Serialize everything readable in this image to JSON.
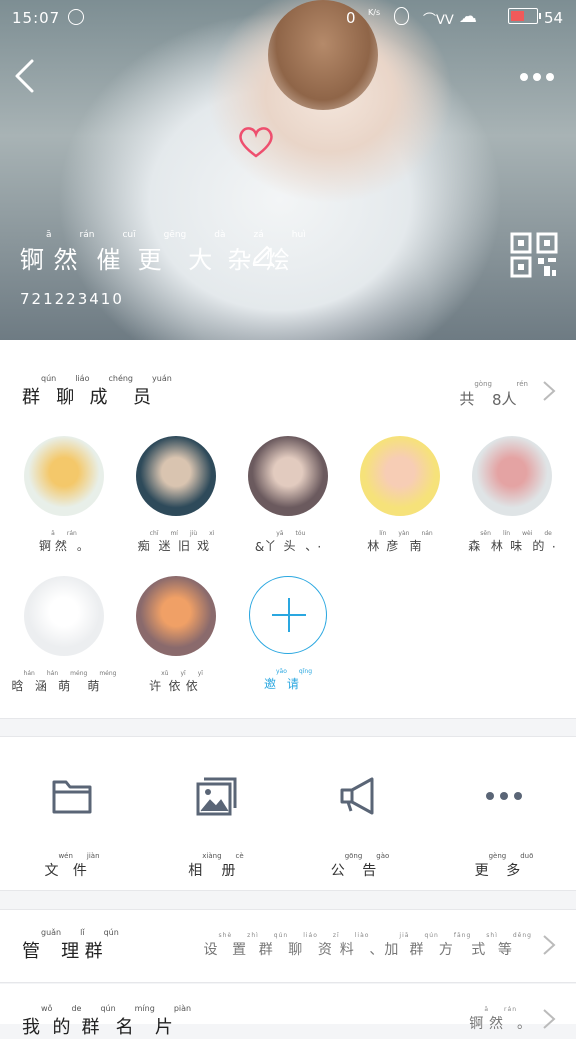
{
  "status_bar": {
    "time": "15:07",
    "speed_value": "0",
    "speed_unit": "K/s",
    "battery_level": "54",
    "battery_fraction": 0.54,
    "battery_color": "#f05a5a",
    "icons": [
      "globe-icon",
      "balloon-icon",
      "bunting-icon",
      "cloud-icon",
      "battery-icon"
    ]
  },
  "header": {
    "group_name": [
      {
        "char": "锕",
        "py": "ā"
      },
      {
        "char": "然",
        "py": "rán"
      },
      {
        "char": "催",
        "py": "cuī"
      },
      {
        "char": "更",
        "py": "gēng"
      },
      {
        "char": "大",
        "py": "dà"
      },
      {
        "char": "杂",
        "py": "zá"
      },
      {
        "char": "烩",
        "py": "huì"
      }
    ],
    "group_id": "721223410"
  },
  "members": {
    "title": [
      {
        "char": "群",
        "py": "qún"
      },
      {
        "char": "聊",
        "py": "liáo"
      },
      {
        "char": "成",
        "py": "chéng"
      },
      {
        "char": "员",
        "py": "yuán"
      }
    ],
    "count": [
      {
        "char": "共",
        "py": "gòng"
      },
      {
        "char": "8",
        "py": ""
      },
      {
        "char": "人",
        "py": "rén"
      }
    ],
    "list": [
      {
        "name": [
          {
            "char": "锕",
            "py": "ā"
          },
          {
            "char": "然",
            "py": "rán"
          },
          {
            "char": "。",
            "py": ""
          }
        ],
        "avatar_bg": "#e8efe9",
        "avatar_accent": "#f4c86a"
      },
      {
        "name": [
          {
            "char": "痴",
            "py": "chī"
          },
          {
            "char": "迷",
            "py": "mí"
          },
          {
            "char": "旧",
            "py": "jiù"
          },
          {
            "char": "戏",
            "py": "xì"
          }
        ],
        "avatar_bg": "#2e4a5a",
        "avatar_accent": "#d9c4b0"
      },
      {
        "name": [
          {
            "char": "&",
            "py": ""
          },
          {
            "char": "丫",
            "py": "yā"
          },
          {
            "char": "头",
            "py": "tóu"
          },
          {
            "char": "、",
            "py": ""
          },
          {
            "char": "·",
            "py": ""
          }
        ],
        "avatar_bg": "#6b5a5e",
        "avatar_accent": "#e2cbbf"
      },
      {
        "name": [
          {
            "char": "林",
            "py": "lín"
          },
          {
            "char": "彦",
            "py": "yàn"
          },
          {
            "char": "南",
            "py": "nán"
          }
        ],
        "avatar_bg": "#f6e27a",
        "avatar_accent": "#f7cdb5"
      },
      {
        "name": [
          {
            "char": "森",
            "py": "sēn"
          },
          {
            "char": "林",
            "py": "lín"
          },
          {
            "char": "味",
            "py": "wèi"
          },
          {
            "char": "的",
            "py": "de"
          },
          {
            "char": "·",
            "py": ""
          }
        ],
        "avatar_bg": "#dfe4e6",
        "avatar_accent": "#e4a3a3"
      },
      {
        "name": [
          {
            "char": "晗",
            "py": "hán"
          },
          {
            "char": "涵",
            "py": "hán"
          },
          {
            "char": "萌",
            "py": "méng"
          },
          {
            "char": "萌",
            "py": "méng"
          }
        ],
        "avatar_bg": "#eceef0",
        "avatar_accent": "#ffffff"
      },
      {
        "name": [
          {
            "char": "许",
            "py": "xǔ"
          },
          {
            "char": "依",
            "py": "yī"
          },
          {
            "char": "依",
            "py": "yī"
          }
        ],
        "avatar_bg": "#8a6a6c",
        "avatar_accent": "#f0a066"
      }
    ],
    "invite": [
      {
        "char": "邀",
        "py": "yāo"
      },
      {
        "char": "请",
        "py": "qǐng"
      }
    ]
  },
  "tools": [
    {
      "icon": "folder-icon",
      "label": [
        {
          "char": "文",
          "py": "wén"
        },
        {
          "char": "件",
          "py": "jiàn"
        }
      ]
    },
    {
      "icon": "album-icon",
      "label": [
        {
          "char": "相",
          "py": "xiàng"
        },
        {
          "char": "册",
          "py": "cè"
        }
      ]
    },
    {
      "icon": "megaphone-icon",
      "label": [
        {
          "char": "公",
          "py": "gōng"
        },
        {
          "char": "告",
          "py": "gào"
        }
      ]
    },
    {
      "icon": "more-dots-icon",
      "label": [
        {
          "char": "更",
          "py": "gèng"
        },
        {
          "char": "多",
          "py": "duō"
        }
      ]
    }
  ],
  "manage": {
    "title": [
      {
        "char": "管",
        "py": "guǎn"
      },
      {
        "char": "理",
        "py": "lǐ"
      },
      {
        "char": "群",
        "py": "qún"
      }
    ],
    "value": [
      {
        "char": "设",
        "py": "shè"
      },
      {
        "char": "置",
        "py": "zhì"
      },
      {
        "char": "群",
        "py": "qún"
      },
      {
        "char": "聊",
        "py": "liáo"
      },
      {
        "char": "资",
        "py": "zī"
      },
      {
        "char": "料",
        "py": "liào"
      },
      {
        "char": "、",
        "py": ""
      },
      {
        "char": "加",
        "py": "jiā"
      },
      {
        "char": "群",
        "py": "qún"
      },
      {
        "char": "方",
        "py": "fāng"
      },
      {
        "char": "式",
        "py": "shì"
      },
      {
        "char": "等",
        "py": "děng"
      }
    ]
  },
  "my_card": {
    "title": [
      {
        "char": "我",
        "py": "wǒ"
      },
      {
        "char": "的",
        "py": "de"
      },
      {
        "char": "群",
        "py": "qún"
      },
      {
        "char": "名",
        "py": "míng"
      },
      {
        "char": "片",
        "py": "piàn"
      }
    ],
    "value": [
      {
        "char": "锕",
        "py": "ā"
      },
      {
        "char": "然",
        "py": "rán"
      },
      {
        "char": "。",
        "py": ""
      }
    ]
  },
  "colors": {
    "accent": "#2aa7e0",
    "icon_gray": "#5a6576",
    "text_dark": "#222222"
  }
}
